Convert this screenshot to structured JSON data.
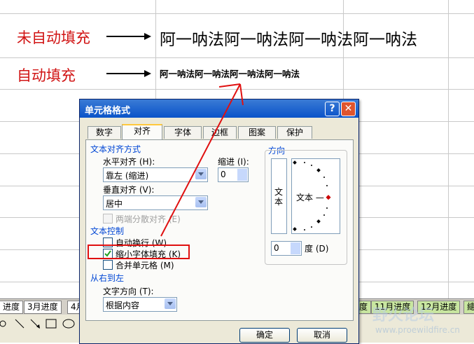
{
  "sheet": {
    "row1_label": "未自动填充",
    "row1_text": "阿一呐法阿一呐法阿一呐法阿一呐法",
    "row2_label": "自动填充",
    "row2_text": "阿一呐法阿一呐法阿一呐法阿一呐法",
    "tabs_left": "进度",
    "tab_march": "3月进度",
    "tab_april": "4月",
    "tabs_right": "度",
    "tab_nov": "11月进度",
    "tab_dec": "12月进度",
    "tab_tail": "總"
  },
  "dialog": {
    "title": "单元格格式",
    "help_btn": "?",
    "close_btn": "✕",
    "tabs": [
      "数字",
      "对齐",
      "字体",
      "边框",
      "图案",
      "保护"
    ],
    "active_tab": "对齐",
    "text_align_group": "文本对齐方式",
    "horizontal_label": "水平对齐 (H):",
    "horizontal_value": "靠左 (缩进)",
    "indent_label": "缩进 (I):",
    "indent_value": "0",
    "vertical_label": "垂直对齐 (V):",
    "vertical_value": "居中",
    "justify_distributed": "两端分散对齐 (E)",
    "text_control_group": "文本控制",
    "wrap_text": "自动换行 (W)",
    "shrink_to_fit": "缩小字体填充 (K)",
    "merge_cells": "合并单元格 (M)",
    "rtl_group": "从右到左",
    "text_direction_label": "文字方向 (T):",
    "text_direction_value": "根据内容",
    "orientation_group": "方向",
    "vertical_text": "文本",
    "orientation_text": "文本 —",
    "degrees_value": "0",
    "degrees_label": "度 (D)",
    "ok": "确定",
    "cancel": "取消"
  },
  "watermark": {
    "site": "www.proewildfire.cn",
    "brand": "野火论坛"
  },
  "colors": {
    "annotation_red": "#e01010",
    "label_red": "#d11414",
    "title_blue": "#0a53c9"
  }
}
